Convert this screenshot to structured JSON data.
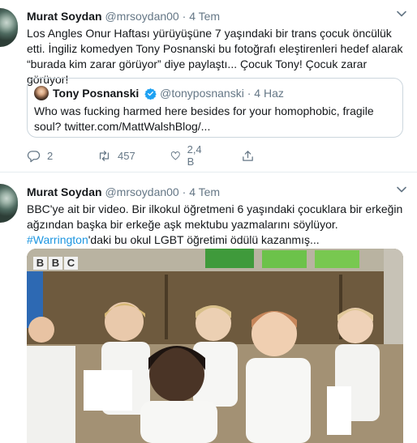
{
  "tweets": [
    {
      "author": {
        "name": "Murat Soydan",
        "handle": "@mrsoydan00",
        "date": "4 Tem"
      },
      "text": "Los Angles Onur Haftası yürüyüşüne 7 yaşındaki bir trans çocuk öncülük etti. İngiliz komedyen Tony Posnanski bu fotoğrafı eleştirenleri hedef alarak “burada kim zarar görüyor” diye paylaştı... Çocuk Tony! Çocuk zarar görüyor!",
      "quoted": {
        "name": "Tony Posnanski",
        "handle": "@tonyposnanski",
        "date": "4 Haz",
        "text": "Who was fucking harmed here besides for your homophobic, fragile soul? twitter.com/MattWalshBlog/..."
      },
      "actions": {
        "replies": "2",
        "retweets": "457",
        "likes": "2,4 B"
      }
    },
    {
      "author": {
        "name": "Murat Soydan",
        "handle": "@mrsoydan00",
        "date": "4 Tem"
      },
      "text_before": "BBC'ye ait bir video. Bir ilkokul öğretmeni 6 yaşındaki çocuklara bir erkeğin ağzından başka bir erkeğe aşk mektubu yazmalarını söylüyor. ",
      "hashtag": "#Warrington",
      "text_after": "'daki bu okul LGBT öğretimi ödülü kazanmış...",
      "media": {
        "logo_letters": [
          "B",
          "B",
          "C"
        ]
      }
    }
  ],
  "separator": "·",
  "colors": {
    "link": "#1b95e0",
    "secondary": "#657786",
    "border": "#e6ecf0"
  },
  "icons": [
    "caret-down-icon",
    "verified-badge-icon",
    "reply-icon",
    "retweet-icon",
    "like-icon",
    "share-icon"
  ]
}
